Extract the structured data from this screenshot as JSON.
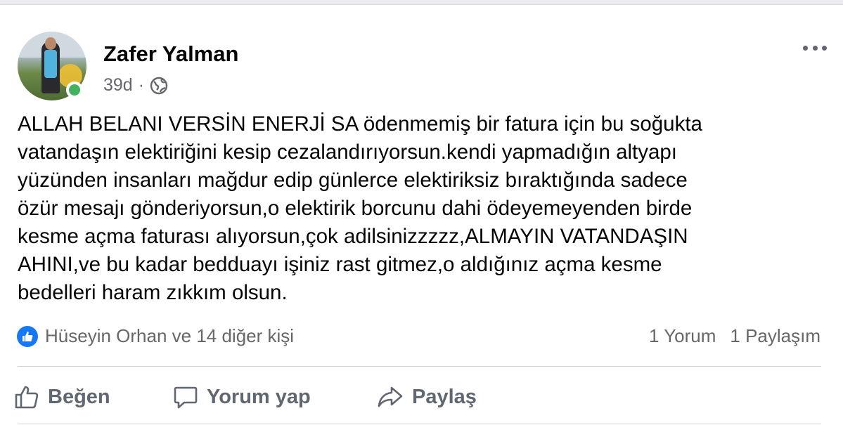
{
  "post": {
    "author": "Zafer Yalman",
    "time": "39d",
    "separator": "·",
    "privacy_icon": "globe-icon",
    "text": "ALLAH BELANI VERSİN ENERJİ SA ödenmemiş bir fatura için bu soğukta\nvatandaşın elektiriğini kesip cezalandırıyorsun.kendi yapmadığın altyapı\nyüzünden insanları mağdur edip günlerce elektiriksiz bıraktığında sadece\nözür mesajı gönderiyorsun,o elektirik borcunu dahi ödeyemeyenden birde\nkesme açma faturası alıyorsun,çok adilsinizzzzz,ALMAYIN VATANDAŞIN\nAHINI,ve bu kadar bedduayı işiniz rast gitmez,o aldığınız açma kesme\nbedelleri haram zıkkım olsun."
  },
  "reactions": {
    "summary": "Hüseyin Orhan ve 14 diğer kişi",
    "comments": "1 Yorum",
    "shares": "1 Paylaşım"
  },
  "actions": {
    "like": "Beğen",
    "comment": "Yorum yap",
    "share": "Paylaş"
  },
  "colors": {
    "accent": "#1877f2",
    "online": "#41b35d",
    "secondary_text": "#65676b"
  }
}
